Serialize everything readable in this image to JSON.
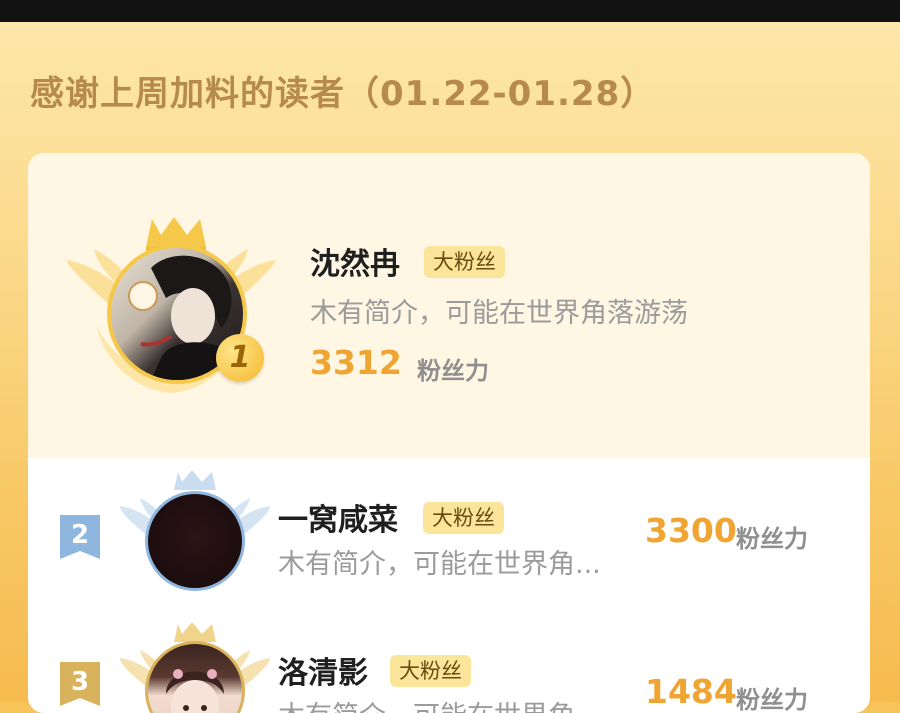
{
  "header": {
    "title": "感谢上周加料的读者（01.22-01.28）"
  },
  "readers": [
    {
      "rank": "1",
      "name": "沈然冉",
      "badge": "大粉丝",
      "bio": "木有简介，可能在世界角落游荡",
      "fans": "3312",
      "fans_label": "粉丝力"
    },
    {
      "rank": "2",
      "name": "一窝咸菜",
      "badge": "大粉丝",
      "bio": "木有简介，可能在世界角...",
      "fans": "3300",
      "fans_label": "粉丝力"
    },
    {
      "rank": "3",
      "name": "洛清影",
      "badge": "大粉丝",
      "bio": "木有简介，可能在世界角...",
      "fans": "1484",
      "fans_label": "粉丝力"
    }
  ],
  "colors": {
    "accent": "#f0a431",
    "gold": "#f6c333",
    "silver": "#8fb6de",
    "bronze": "#d9b25c"
  }
}
